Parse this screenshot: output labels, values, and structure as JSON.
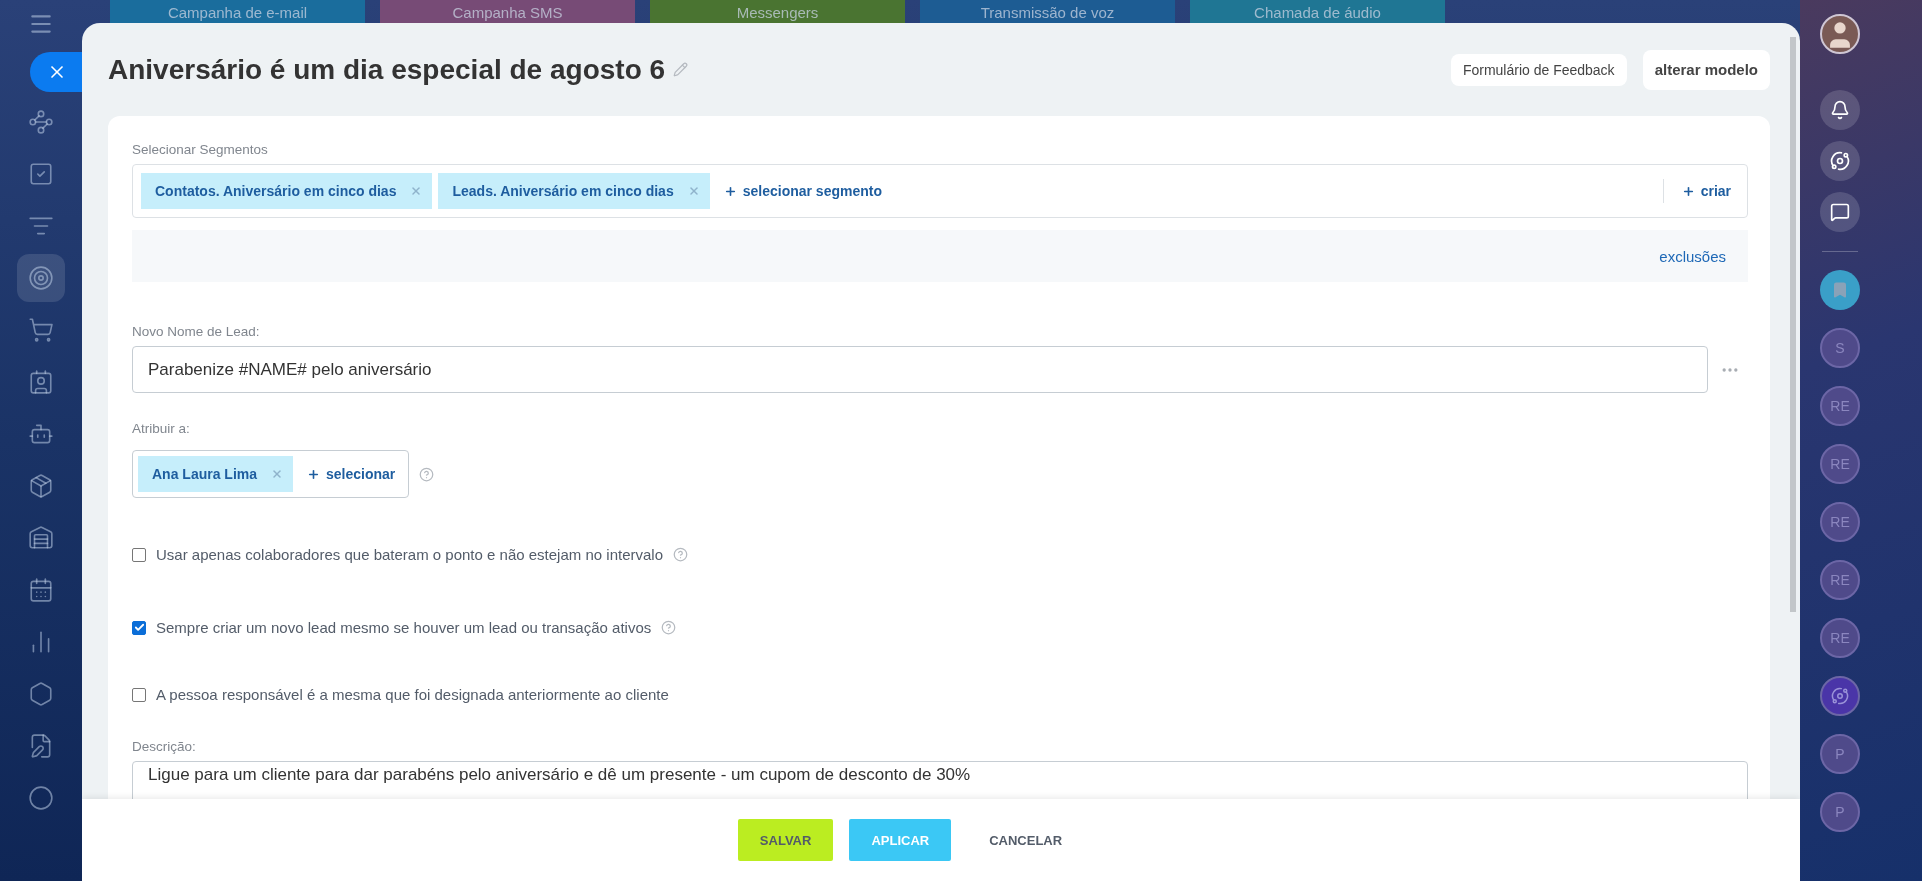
{
  "background_tabs": [
    {
      "label": "Campanha de e-mail",
      "color": "#1a6d9d"
    },
    {
      "label": "Campanha SMS",
      "color": "#774b76"
    },
    {
      "label": "Messengers",
      "color": "#4a7431"
    },
    {
      "label": "Transmissão de voz",
      "color": "#1d5c93"
    },
    {
      "label": "Chamada de áudio",
      "color": "#1f7694"
    }
  ],
  "left_sidebar": {
    "items": [
      {
        "kind": "network",
        "selected": false
      },
      {
        "kind": "task",
        "selected": false
      },
      {
        "kind": "funnel",
        "selected": false
      },
      {
        "kind": "target",
        "selected": true
      },
      {
        "kind": "cart",
        "selected": false
      },
      {
        "kind": "contact",
        "selected": false
      },
      {
        "kind": "robot",
        "selected": false
      },
      {
        "kind": "box",
        "selected": false
      },
      {
        "kind": "warehouse",
        "selected": false
      },
      {
        "kind": "calendar",
        "selected": false
      },
      {
        "kind": "chart",
        "selected": false
      },
      {
        "kind": "hexagon",
        "selected": false
      },
      {
        "kind": "document",
        "selected": false
      },
      {
        "kind": "faint",
        "selected": false
      }
    ]
  },
  "right_sidebar": {
    "items": [
      {
        "kind": "avatar"
      },
      {
        "kind": "bell"
      },
      {
        "kind": "orbit"
      },
      {
        "kind": "chat"
      },
      {
        "kind": "divider"
      },
      {
        "kind": "bookmark"
      },
      {
        "kind": "letter",
        "text": "S"
      },
      {
        "kind": "letter",
        "text": "RE"
      },
      {
        "kind": "letter",
        "text": "RE"
      },
      {
        "kind": "letter",
        "text": "RE"
      },
      {
        "kind": "letter",
        "text": "RE"
      },
      {
        "kind": "letter",
        "text": "RE"
      },
      {
        "kind": "swirl"
      },
      {
        "kind": "letter",
        "text": "P"
      },
      {
        "kind": "letter",
        "text": "P"
      }
    ]
  },
  "panel": {
    "title": "Aniversário é um dia especial de agosto 6",
    "header_buttons": [
      {
        "label": "Formulário de Feedback",
        "bold": false
      },
      {
        "label": "alterar modelo",
        "bold": true
      }
    ],
    "segments": {
      "label": "Selecionar Segmentos",
      "tags": [
        "Contatos. Aniversário em cinco dias",
        "Leads. Aniversário em cinco dias"
      ],
      "add_link": "selecionar segmento",
      "create_link": "criar"
    },
    "exclusions_link": "exclusões",
    "lead_name": {
      "label": "Novo Nome de Lead:",
      "value": "Parabenize #NAME# pelo aniversário"
    },
    "assign": {
      "label": "Atribuir a:",
      "tags": [
        "Ana Laura Lima"
      ],
      "add_link": "selecionar"
    },
    "options": [
      {
        "label": "Usar apenas colaboradores que bateram o ponto e não estejam no intervalo",
        "checked": false,
        "help": true
      },
      {
        "label": "Sempre criar um novo lead mesmo se houver um lead ou transação ativos",
        "checked": true,
        "help": true
      },
      {
        "label": "A pessoa responsável é a mesma que foi designada anteriormente ao cliente",
        "checked": false,
        "help": false
      }
    ],
    "description": {
      "label": "Descrição:",
      "value": "Ligue para um cliente para dar parabéns pelo aniversário e dê um presente - um cupom de desconto de 30%"
    }
  },
  "footer": {
    "buttons": [
      {
        "label": "SALVAR",
        "kind": "save"
      },
      {
        "label": "APLICAR",
        "kind": "apply"
      },
      {
        "label": "CANCELAR",
        "kind": "cancel"
      }
    ]
  }
}
